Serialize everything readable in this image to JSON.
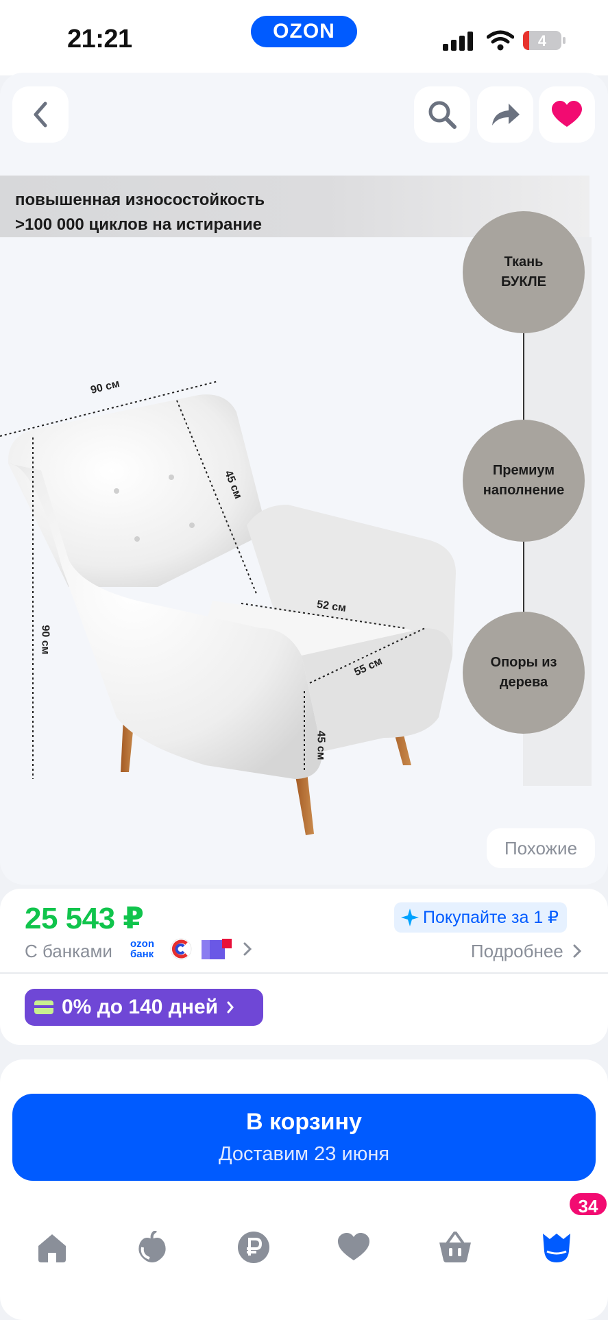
{
  "status_bar": {
    "time": "21:21",
    "logo": "OZON",
    "battery": "4"
  },
  "top_actions": {
    "back_icon": "chevron-left-icon",
    "search_icon": "search-icon",
    "share_icon": "share-icon",
    "favorite_icon": "heart-icon"
  },
  "hero": {
    "banner_line1": "повышенная износостойкость",
    "banner_line2": ">100 000 циклов на истирание",
    "feature1_line1": "Ткань",
    "feature1_line2": "БУКЛЕ",
    "feature2_line1": "Премиум",
    "feature2_line2": "наполнение",
    "feature3_line1": "Опоры из",
    "feature3_line2": "дерева",
    "dim_width": "90 см",
    "dim_back": "45 см",
    "dim_height": "90 см",
    "dim_seat_width": "52 см",
    "dim_seat_depth": "55 см",
    "dim_leg": "45 см"
  },
  "similar_label": "Похожие",
  "price": {
    "value": "25 543 ₽",
    "buy_for": "Покупайте за 1 ₽",
    "banks_label": "С банками",
    "ozon_bank": "ozon банк",
    "details": "Подробнее",
    "installment": "0% до 140 дней"
  },
  "cart": {
    "label": "В корзину",
    "delivery": "Доставим 23 июня"
  },
  "nav": {
    "items": [
      "home-icon",
      "fresh-icon",
      "ruble-icon",
      "favorites-icon",
      "cart-icon",
      "profile-icon"
    ],
    "badge": "34"
  },
  "colors": {
    "accent": "#005bff",
    "price_green": "#10c44c",
    "installment_purple": "#6f47d6",
    "badge_pink": "#f20b71"
  }
}
